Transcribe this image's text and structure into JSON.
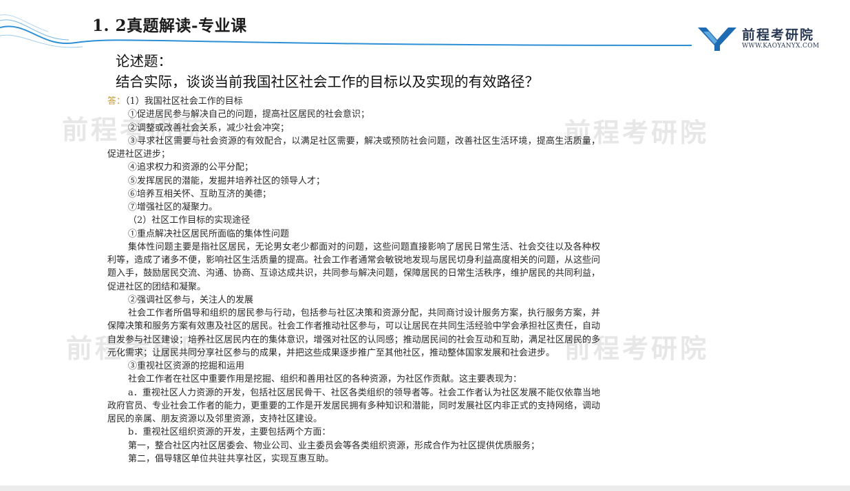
{
  "header": {
    "title": "1. 2真题解读-专业课",
    "logo_name": "前程考研院",
    "logo_url": "WWW.KAOYANYX.COM"
  },
  "watermark": {
    "text": "前程考研院"
  },
  "question": {
    "label": "论述题：",
    "text": "结合实际，谈谈当前我国社区社会工作的目标以及实现的有效路径？"
  },
  "answer": {
    "marker": "答：",
    "lines": [
      "（1）我国社区社会工作的目标",
      "①促进居民参与解决自己的问题，提高社区居民的社会意识；",
      "②调整或改善社会关系，减少社会冲突；",
      "③寻求社区需要与社会资源的有效配合，以满足社区需要，解决或预防社会问题，改善社区生活环境，提高生活质量，促进社区进步；",
      "④追求权力和资源的公平分配；",
      "⑤发挥居民的潜能，发掘并培养社区的领导人才；",
      "⑥培养互相关怀、互助互济的美德；",
      "⑦增强社区的凝聚力。",
      "（2）社区工作目标的实现途径",
      "①重点解决社区居民所面临的集体性问题",
      "集体性问题主要是指社区居民，无论男女老少都面对的问题，这些问题直接影响了居民日常生活、社会交往以及各种权利等，造成了诸多不便，影响社区生活质量的提高。社会工作者通常会敏锐地发现与居民切身利益高度相关的问题，从这些问题入手，鼓励居民交流、沟通、协商、互谅达成共识，共同参与解决问题，保障居民的日常生活秩序，维护居民的共同利益，促进社区的团结和凝聚。",
      "②强调社区参与，关注人的发展",
      "社会工作者所倡导和组织的居民参与行动，包括参与社区决策和资源分配，共同商讨设计服务方案，执行服务方案，并保障决策和服务方案有效惠及社区的居民。社会工作者推动社区参与，可以让居民在共同生活经验中学会承担社区责任，自动自发参与社区建设；培养社区居民内在的集体意识，增强对社区的认同感；推动居民间的社会互动和互助，满足社区居民的多元化需求；让居民共同分享社区参与的成果，并把这些成果逐步推广至其他社区，推动整体国家发展和社会进步。",
      "③重视社区资源的挖掘和运用",
      "社会工作者在社区中重要作用是挖掘、组织和善用社区的各种资源，为社区作贡献。这主要表现为：",
      "a．重视社区人力资源的开发，包括社区居民骨干、社区各类组织的领导者等。社会工作者认为社区发展不能仅依靠当地政府官员、专业社会工作者的能力，更重要的工作是开发居民拥有多种知识和潜能，同时发展社区内非正式的支持网络，调动居民的亲属、朋友资源以及邻里资源，支持社区建设。",
      "b．重视社区组织资源的开发，主要包括两个方面：",
      "第一，整合社区内社区居委会、物业公司、业主委员会等各类组织资源，形成合作为社区提供优质服务；",
      "第二，倡导辖区单位共驻共享社区，实现互惠互助。"
    ]
  },
  "colors": {
    "accent_blue": "#1f6fb5",
    "logo_blue": "#1e6ab3",
    "answer_marker": "#c99b2f",
    "watermark": "#e7e7e7"
  }
}
